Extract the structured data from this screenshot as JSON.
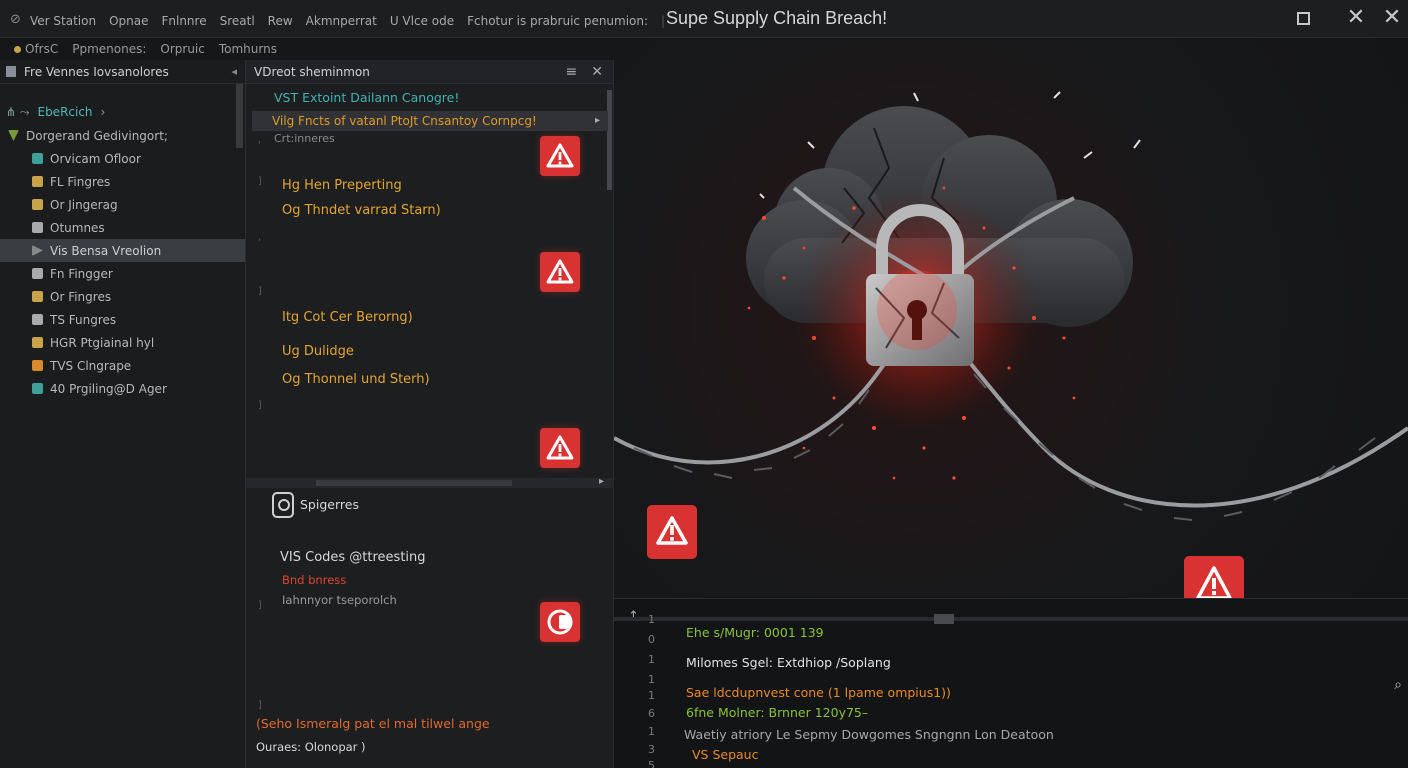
{
  "window": {
    "title": "Supe Supply Chain Breach!",
    "menu": [
      "Ver Station",
      "Opnae",
      "Fnlnnre",
      "Sreatl",
      "Rew",
      "Akmnperrat",
      "U Vlce ode",
      "Fchotur is prabruic penumion:"
    ],
    "toolbar": [
      "OfrsC",
      "Ppmenones:",
      "Orpruic",
      "Tomhurns"
    ]
  },
  "explorer": {
    "header": "Fre  Vennes Iovsanolores",
    "root": "EbeRcich",
    "items": [
      {
        "label": "Dorgerand Gedivingort;",
        "icon": "chevron-down-icon",
        "color": "#7a9a3a"
      },
      {
        "label": "Orvicam Ofloor",
        "icon": "file-icon",
        "color": "#3fa09a"
      },
      {
        "label": "FL Fingres",
        "icon": "file-icon",
        "color": "#c9a34b"
      },
      {
        "label": "Or Jingerag",
        "icon": "gear-icon",
        "color": "#c9a34b"
      },
      {
        "label": "Otumnes",
        "icon": "box-icon",
        "color": "#aaaaaa"
      },
      {
        "label": "Vis Bensa Vreolion",
        "icon": "chevron-right-icon",
        "color": "#888888"
      },
      {
        "label": "Fn Fingger",
        "icon": "settings-icon",
        "color": "#aaaaaa"
      },
      {
        "label": "Or Fingres",
        "icon": "settings-icon",
        "color": "#c9a34b"
      },
      {
        "label": "TS Fungres",
        "icon": "ts-icon",
        "color": "#aaaaaa"
      },
      {
        "label": "HGR Ptgiainal hyl",
        "icon": "package-icon",
        "color": "#c9a34b"
      },
      {
        "label": "TVS Clngrape",
        "icon": "package-icon",
        "color": "#d68a2a"
      },
      {
        "label": "40 Prgiling@D Ager",
        "icon": "leaf-icon",
        "color": "#3fa09a"
      }
    ]
  },
  "problems": {
    "header": "VDreot sheminmon",
    "row1": "VST  Extoint Dailann Canogre!",
    "row2": "Vilg  Fncts  of  vatanl  PtoJt Cnsantoy  Cornpcg!",
    "row3": "Crt:inneres",
    "e1_line1": "Hg Hen Preperting",
    "e1_line2": "Og Thndet varrad Starn)",
    "e2_line1": "Itg Cot Cer Berorng)",
    "e3_line1": "Ug Dulidge",
    "e3_line2": "Og Thonnel und Sterh)",
    "section": "Spigerres",
    "section_title": "VIS Codes @ttreesting",
    "section_red": "Bnd bnress",
    "section_grey": "Iahnnyor tseporolch",
    "footer1": "(Seho Ismeralg pat el mal tilwel ange",
    "footer2": "Ouraes: Olonopar )"
  },
  "terminal": {
    "line_numbers": [
      "1",
      "0",
      "1",
      "1",
      "1",
      "6",
      "1",
      "3",
      "5"
    ],
    "lines": [
      {
        "text": "Ehe s/Mugr: 0001 139",
        "style": "green"
      },
      {
        "text": "Milomes Sgel: Extdhiop ∕Soplang",
        "style": "white"
      },
      {
        "text": "Sae ldcdupnvest cone (1 lpame ompius1))",
        "style": "orange"
      },
      {
        "text": "6fne Molner: Brnner 120y75–",
        "style": "green"
      },
      {
        "text": "Waetiy atriory Le Sepmy Dowgomes Sngngnn  Lon Deatoon",
        "style": "grey"
      },
      {
        "text": "VS Sepauc",
        "style": "orange"
      }
    ]
  },
  "colors": {
    "accent_red": "#d93232",
    "accent_teal": "#3fb3b3",
    "accent_amber": "#e3a532"
  }
}
